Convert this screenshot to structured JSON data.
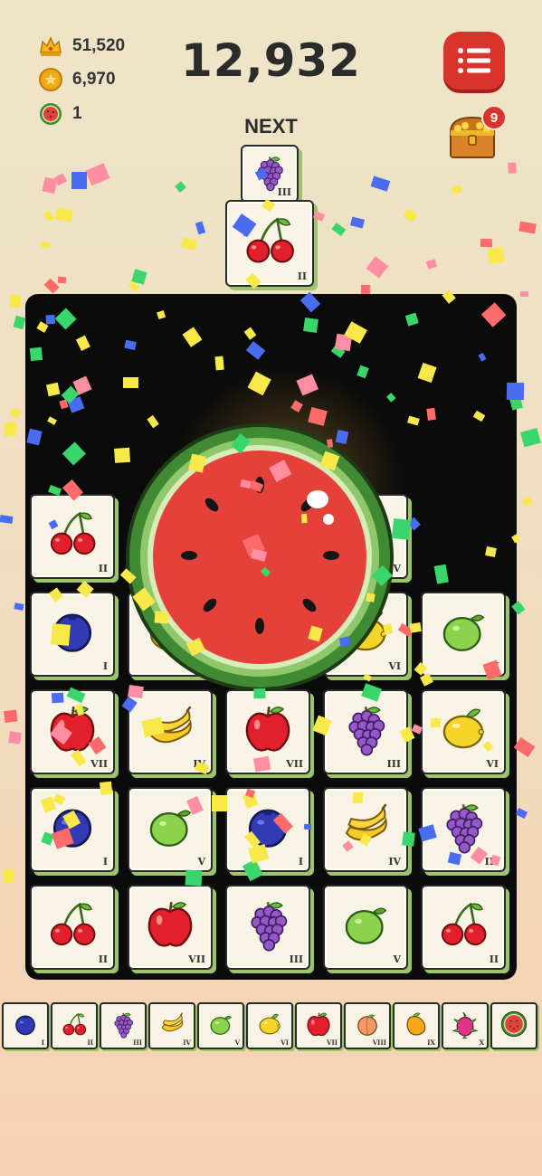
{
  "hud": {
    "crowns": "51,520",
    "coins": "6,970",
    "watermelons": "1",
    "score": "12,932",
    "chest_badge": "9",
    "next_label": "NEXT"
  },
  "icons": {
    "crown": "crown-icon",
    "coin": "star-coin-icon",
    "watermelon": "watermelon-icon",
    "menu": "list-menu-icon",
    "chest": "treasure-chest-icon"
  },
  "next_queue": [
    {
      "fruit": "grape",
      "level": "III"
    },
    {
      "fruit": "cherry",
      "level": "II"
    }
  ],
  "board": {
    "rows": [
      [
        {
          "fruit": "cherry",
          "level": "II"
        },
        null,
        null,
        {
          "fruit": "lime",
          "level": "V"
        },
        null
      ],
      [
        {
          "fruit": "blueberry",
          "level": "I"
        },
        {
          "fruit": "lemon",
          "level": "VI"
        },
        null,
        {
          "fruit": "lemon",
          "level": "VI"
        },
        {
          "fruit": "lime",
          "level": "V"
        }
      ],
      [
        {
          "fruit": "apple",
          "level": "VII"
        },
        {
          "fruit": "banana",
          "level": "IV"
        },
        {
          "fruit": "apple",
          "level": "VII"
        },
        {
          "fruit": "grape",
          "level": "III"
        },
        {
          "fruit": "lemon",
          "level": "VI"
        }
      ],
      [
        {
          "fruit": "blueberry",
          "level": "I"
        },
        {
          "fruit": "lime",
          "level": "V"
        },
        {
          "fruit": "blueberry",
          "level": "I"
        },
        {
          "fruit": "banana",
          "level": "IV"
        },
        {
          "fruit": "grape",
          "level": "III"
        }
      ],
      [
        {
          "fruit": "cherry",
          "level": "II"
        },
        {
          "fruit": "apple",
          "level": "VII"
        },
        {
          "fruit": "grape",
          "level": "III"
        },
        {
          "fruit": "lime",
          "level": "V"
        },
        {
          "fruit": "cherry",
          "level": "II"
        }
      ]
    ],
    "merged_fruit": "watermelon"
  },
  "legend": [
    {
      "fruit": "blueberry",
      "level": "I"
    },
    {
      "fruit": "cherry",
      "level": "II"
    },
    {
      "fruit": "grape",
      "level": "III"
    },
    {
      "fruit": "banana",
      "level": "IV"
    },
    {
      "fruit": "lime",
      "level": "V"
    },
    {
      "fruit": "lemon",
      "level": "VI"
    },
    {
      "fruit": "apple",
      "level": "VII"
    },
    {
      "fruit": "peach",
      "level": "VIII"
    },
    {
      "fruit": "mango",
      "level": "IX"
    },
    {
      "fruit": "dragonfruit",
      "level": "X"
    },
    {
      "fruit": "watermelon",
      "level": ""
    }
  ],
  "colors": {
    "accent_red": "#d9342b",
    "tile_shadow": "#9bc46c",
    "board_bg": "#0b0b0b"
  }
}
